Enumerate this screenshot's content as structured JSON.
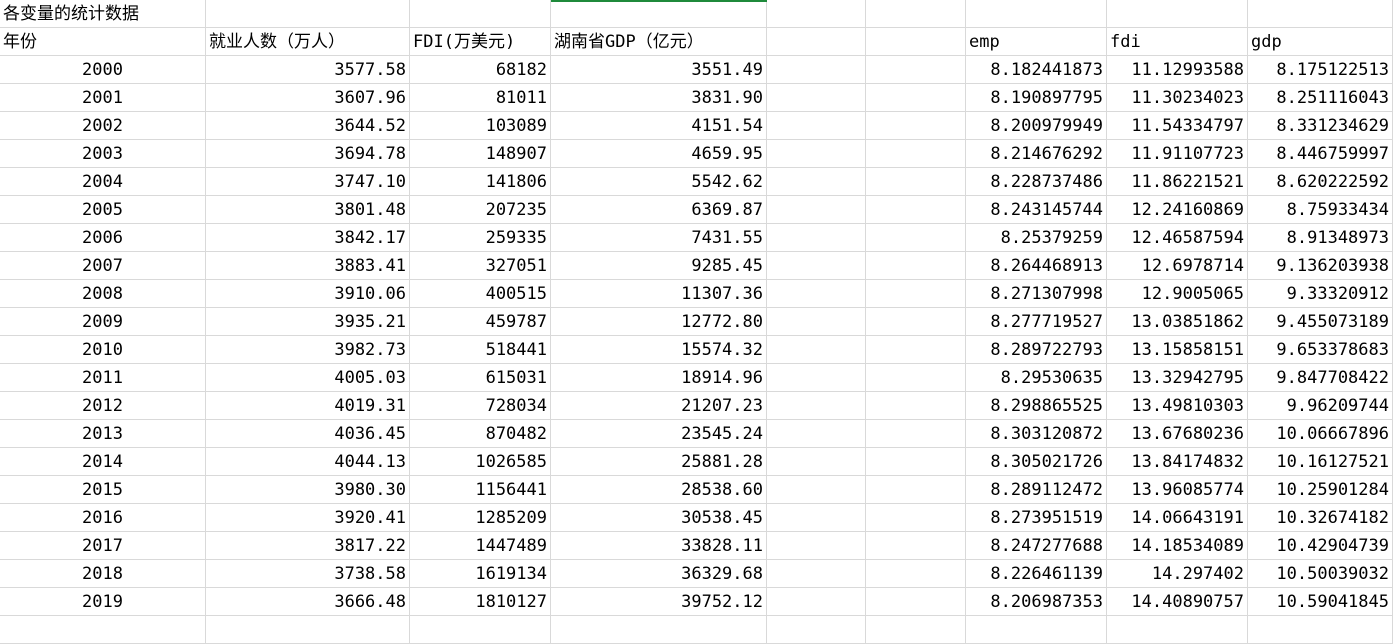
{
  "sheet": {
    "title": "各变量的统计数据",
    "headers": {
      "year": "年份",
      "employment": "就业人数（万人）",
      "fdi": "FDI(万美元)",
      "gdp": "湖南省GDP（亿元）",
      "log_emp": "emp",
      "log_fdi": "fdi",
      "log_gdp": "gdp"
    },
    "rows": [
      [
        "2000",
        "3577.58",
        "68182",
        "3551.49",
        "8.182441873",
        "11.12993588",
        "8.175122513"
      ],
      [
        "2001",
        "3607.96",
        "81011",
        "3831.90",
        "8.190897795",
        "11.30234023",
        "8.251116043"
      ],
      [
        "2002",
        "3644.52",
        "103089",
        "4151.54",
        "8.200979949",
        "11.54334797",
        "8.331234629"
      ],
      [
        "2003",
        "3694.78",
        "148907",
        "4659.95",
        "8.214676292",
        "11.91107723",
        "8.446759997"
      ],
      [
        "2004",
        "3747.10",
        "141806",
        "5542.62",
        "8.228737486",
        "11.86221521",
        "8.620222592"
      ],
      [
        "2005",
        "3801.48",
        "207235",
        "6369.87",
        "8.243145744",
        "12.24160869",
        "8.75933434"
      ],
      [
        "2006",
        "3842.17",
        "259335",
        "7431.55",
        "8.25379259",
        "12.46587594",
        "8.91348973"
      ],
      [
        "2007",
        "3883.41",
        "327051",
        "9285.45",
        "8.264468913",
        "12.6978714",
        "9.136203938"
      ],
      [
        "2008",
        "3910.06",
        "400515",
        "11307.36",
        "8.271307998",
        "12.9005065",
        "9.33320912"
      ],
      [
        "2009",
        "3935.21",
        "459787",
        "12772.80",
        "8.277719527",
        "13.03851862",
        "9.455073189"
      ],
      [
        "2010",
        "3982.73",
        "518441",
        "15574.32",
        "8.289722793",
        "13.15858151",
        "9.653378683"
      ],
      [
        "2011",
        "4005.03",
        "615031",
        "18914.96",
        "8.29530635",
        "13.32942795",
        "9.847708422"
      ],
      [
        "2012",
        "4019.31",
        "728034",
        "21207.23",
        "8.298865525",
        "13.49810303",
        "9.96209744"
      ],
      [
        "2013",
        "4036.45",
        "870482",
        "23545.24",
        "8.303120872",
        "13.67680236",
        "10.06667896"
      ],
      [
        "2014",
        "4044.13",
        "1026585",
        "25881.28",
        "8.305021726",
        "13.84174832",
        "10.16127521"
      ],
      [
        "2015",
        "3980.30",
        "1156441",
        "28538.60",
        "8.289112472",
        "13.96085774",
        "10.25901284"
      ],
      [
        "2016",
        "3920.41",
        "1285209",
        "30538.45",
        "8.273951519",
        "14.06643191",
        "10.32674182"
      ],
      [
        "2017",
        "3817.22",
        "1447489",
        "33828.11",
        "8.247277688",
        "14.18534089",
        "10.42904739"
      ],
      [
        "2018",
        "3738.58",
        "1619134",
        "36329.68",
        "8.226461139",
        "14.297402",
        "10.50039032"
      ],
      [
        "2019",
        "3666.48",
        "1810127",
        "39752.12",
        "8.206987353",
        "14.40890757",
        "10.59041845"
      ]
    ]
  }
}
